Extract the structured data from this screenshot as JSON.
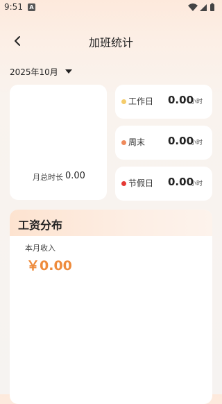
{
  "status_bar": {
    "time": "9:51",
    "left_icon": "A",
    "icons": [
      "wifi-icon",
      "signal-icon",
      "battery-icon"
    ]
  },
  "header": {
    "back_icon": "back-arrow-icon",
    "title": "加班统计"
  },
  "month_selector": {
    "value": "2025年10月",
    "caret_icon": "caret-down-icon"
  },
  "summary": {
    "total_label": "月总时长",
    "total_value": "0.00"
  },
  "overtime_types": [
    {
      "name": "工作日",
      "value": "0.00",
      "unit": "小时",
      "color": "#f5cc6b"
    },
    {
      "name": "周末",
      "value": "0.00",
      "unit": "小时",
      "color": "#ef8a5b"
    },
    {
      "name": "节假日",
      "value": "0.00",
      "unit": "小时",
      "color": "#e53935"
    }
  ],
  "salary": {
    "title": "工资分布",
    "income_label": "本月收入",
    "income_value": "￥0.00"
  },
  "colors": {
    "accent": "#ee8b3c",
    "background_top": "#fde9dc"
  }
}
